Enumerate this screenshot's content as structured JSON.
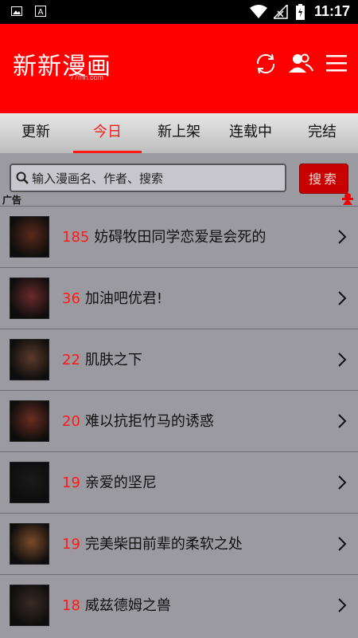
{
  "status_bar": {
    "time": "11:17"
  },
  "app": {
    "logo": "新新漫画",
    "logo_sub": "77mh.com"
  },
  "tabs": [
    {
      "label": "更新"
    },
    {
      "label": "今日"
    },
    {
      "label": "新上架"
    },
    {
      "label": "连载中"
    },
    {
      "label": "完结"
    }
  ],
  "active_tab": "今日",
  "search": {
    "placeholder": "输入漫画名、作者、搜索",
    "button": "搜索"
  },
  "ad_label": "广告",
  "list": [
    {
      "num": "185",
      "title": "妨碍牧田同学恋爱是会死的",
      "color": "#5a2a1a"
    },
    {
      "num": "36",
      "title": "加油吧优君!",
      "color": "#6a2a2a"
    },
    {
      "num": "22",
      "title": "肌肤之下",
      "color": "#5b3a2a"
    },
    {
      "num": "20",
      "title": "难以抗拒竹马的诱惑",
      "color": "#6b2d20"
    },
    {
      "num": "19",
      "title": "亲爱的坚尼",
      "color": "#1a1a1a"
    },
    {
      "num": "19",
      "title": "完美柴田前辈的柔软之处",
      "color": "#7a4a2a"
    },
    {
      "num": "18",
      "title": "威兹德姆之兽",
      "color": "#3a2a24"
    }
  ],
  "colors": {
    "brand": "#ff0000",
    "accent": "#ff1a1a",
    "list_bg": "#9a9aa0"
  }
}
